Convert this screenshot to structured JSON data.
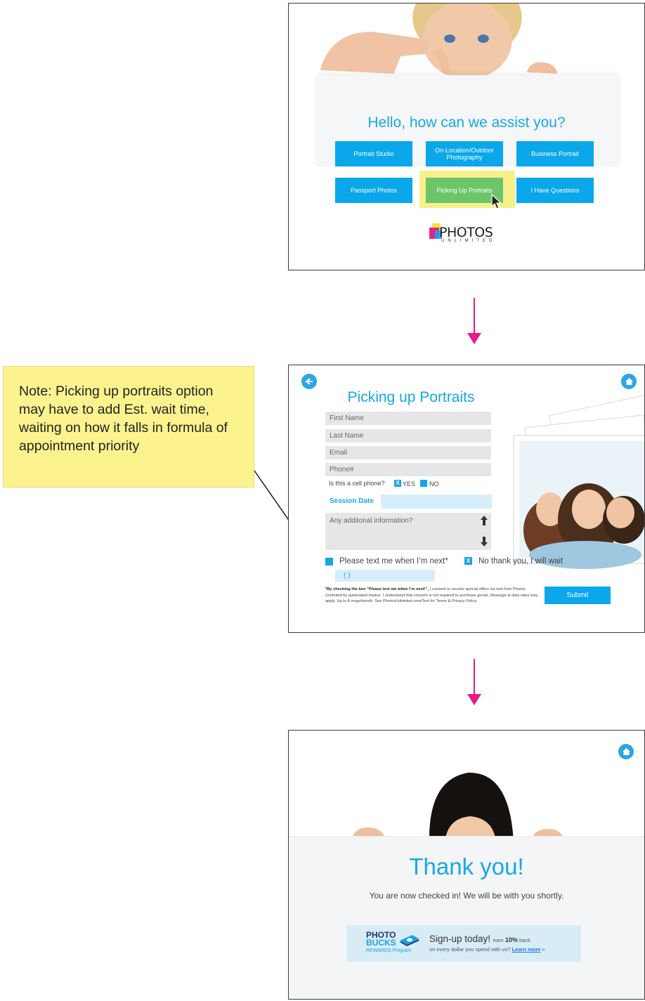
{
  "colors": {
    "accent": "#0aa7ea",
    "title_blue": "#18a7e6",
    "selected_green": "#6cc56a",
    "highlight_yellow": "#f6f08a",
    "arrow_pink": "#e8198b",
    "note_yellow": "#fdf38e"
  },
  "screen1": {
    "greeting": "Hello, how can we assist you?",
    "options": [
      "Portrait Studio",
      "On-Location/Outdoor Photography",
      "Business Portrait",
      "Passport Photos",
      "Picking Up Portraits",
      "I Have Questions"
    ],
    "selected_option": "Picking Up Portraits",
    "logo_word": "PHOTOS",
    "logo_sub": "UNLIMITED"
  },
  "note": {
    "text": "Note: Picking up portraits option may have to add Est. wait time, waiting on how it falls in formula of appointment priority"
  },
  "screen2": {
    "title": "Picking up Portraits",
    "fields": {
      "first_name": "First Name",
      "last_name": "Last Name",
      "email": "Email",
      "phone": "Phone#"
    },
    "cell_question": "Is this a cell phone?",
    "yes_label": "YES",
    "no_label": "NO",
    "yes_mark": "X",
    "session_date_label": "Session Date",
    "additional_info": "Any additonal information?",
    "text_me_label": "Please text me when I’m next*",
    "no_thanks_label": "No thank you, I will wait",
    "no_thanks_mark": "X",
    "phone_placeholder": "(      )",
    "legal_bold": "*By checking the box “Please text me when I’m next!”,",
    "legal_text": " I consent to receive special offers via text  from Photos Unlimited by automated means. I understand that consent is not required to purchase goods. Message & data rates may apply. Up to 8 msgs/month. See PhotosUnlimited.com/Text for Terms & Privacy Policy.",
    "submit_label": "Submit",
    "icons": {
      "back": "back-arrow-icon",
      "home": "home-icon"
    }
  },
  "screen3": {
    "title": "Thank you!",
    "subtitle": "You are now checked in! We will be with you shortly.",
    "promo": {
      "brand_line1": "PHOTO",
      "brand_line2": "BUCKS",
      "brand_sub": "REWARDS Program",
      "headline": "Sign-up today!",
      "earn_pre": "earn",
      "earn_pct": "10%",
      "earn_post": "back",
      "line2": "on every dollar you spend with us?",
      "link": "Learn more",
      "link_suffix": "»"
    }
  }
}
